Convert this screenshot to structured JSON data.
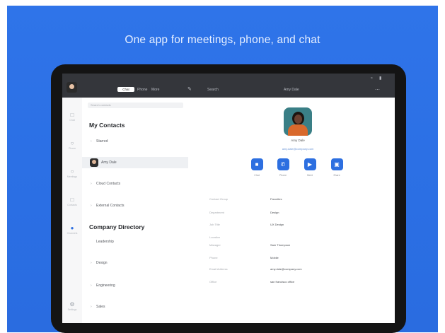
{
  "headline": "One app for meetings, phone, and chat",
  "colors": {
    "background": "#2b6fe4",
    "accent": "#2d6fe0",
    "topbar": "#34363b"
  },
  "topbar": {
    "tab_active": "Chat",
    "tab_2": "Phone",
    "tab_3": "More",
    "search": "Search",
    "center_title": "Amy Dale",
    "right_icons": [
      "wifi-icon",
      "battery-icon"
    ]
  },
  "rail": [
    {
      "icon": "chat-icon",
      "label": "Chat"
    },
    {
      "icon": "phone-icon",
      "label": "Phone"
    },
    {
      "icon": "meetings-icon",
      "label": "Meetings"
    },
    {
      "icon": "contacts-icon",
      "label": "Contacts"
    },
    {
      "icon": "channels-icon",
      "label": "Channels"
    },
    {
      "icon": "settings-icon",
      "label": "Settings"
    }
  ],
  "list": {
    "search_placeholder": "Search contacts",
    "my_contacts_title": "My Contacts",
    "company_title": "Company Directory",
    "my_contacts": [
      {
        "label": "Starred",
        "type": "group"
      },
      {
        "label": "Amy Dale",
        "type": "person"
      },
      {
        "label": "Cloud Contacts",
        "type": "group"
      },
      {
        "label": "External Contacts",
        "type": "group"
      }
    ],
    "company": [
      {
        "label": "Leadership"
      },
      {
        "label": "Design"
      },
      {
        "label": "Engineering"
      },
      {
        "label": "Sales"
      }
    ]
  },
  "profile": {
    "name": "Amy Dale",
    "email": "amy.dale@company.com",
    "actions": [
      {
        "icon": "chat-bubble-icon",
        "label": "Chat"
      },
      {
        "icon": "phone-icon",
        "label": "Phone"
      },
      {
        "icon": "video-icon",
        "label": "Meet"
      },
      {
        "icon": "screen-share-icon",
        "label": "Share"
      }
    ],
    "fields": [
      {
        "label": "Contact Group",
        "value": "Favorites"
      },
      {
        "label": "Department",
        "value": "Design"
      },
      {
        "label": "Job Title",
        "value": "UX Design"
      },
      {
        "label": "Location",
        "value": ""
      },
      {
        "label": "Manager",
        "value": "Sam Thompson"
      },
      {
        "label": "Phone",
        "value": "Mobile"
      },
      {
        "label": "Email Address",
        "value": "amy.dale@company.com"
      },
      {
        "label": "Office",
        "value": "san francisco office"
      }
    ]
  }
}
